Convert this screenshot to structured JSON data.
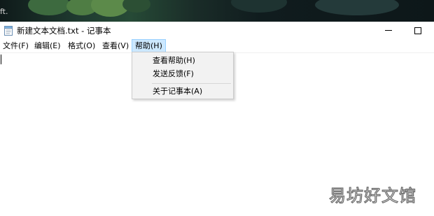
{
  "desktop": {
    "wallpaper_text": "ft."
  },
  "window": {
    "title": "新建文本文档.txt - 记事本",
    "icon": "notepad-icon",
    "controls": [
      "minimize-icon",
      "maximize-icon"
    ]
  },
  "menubar": {
    "items": [
      {
        "label": "文件(F)"
      },
      {
        "label": "编辑(E)"
      },
      {
        "label": "格式(O)"
      },
      {
        "label": "查看(V)"
      },
      {
        "label": "帮助(H)",
        "active": true
      }
    ]
  },
  "help_menu": {
    "items": [
      {
        "label": "查看帮助(H)"
      },
      {
        "label": "发送反馈(F)"
      },
      {
        "label": "关于记事本(A)"
      }
    ]
  },
  "editor": {
    "content": ""
  },
  "watermark": {
    "text": "易坊好文馆"
  },
  "colors": {
    "active_menu_bg": "#cce8ff",
    "active_menu_border": "#99d1ff",
    "dropdown_bg": "#f2f2f2"
  }
}
